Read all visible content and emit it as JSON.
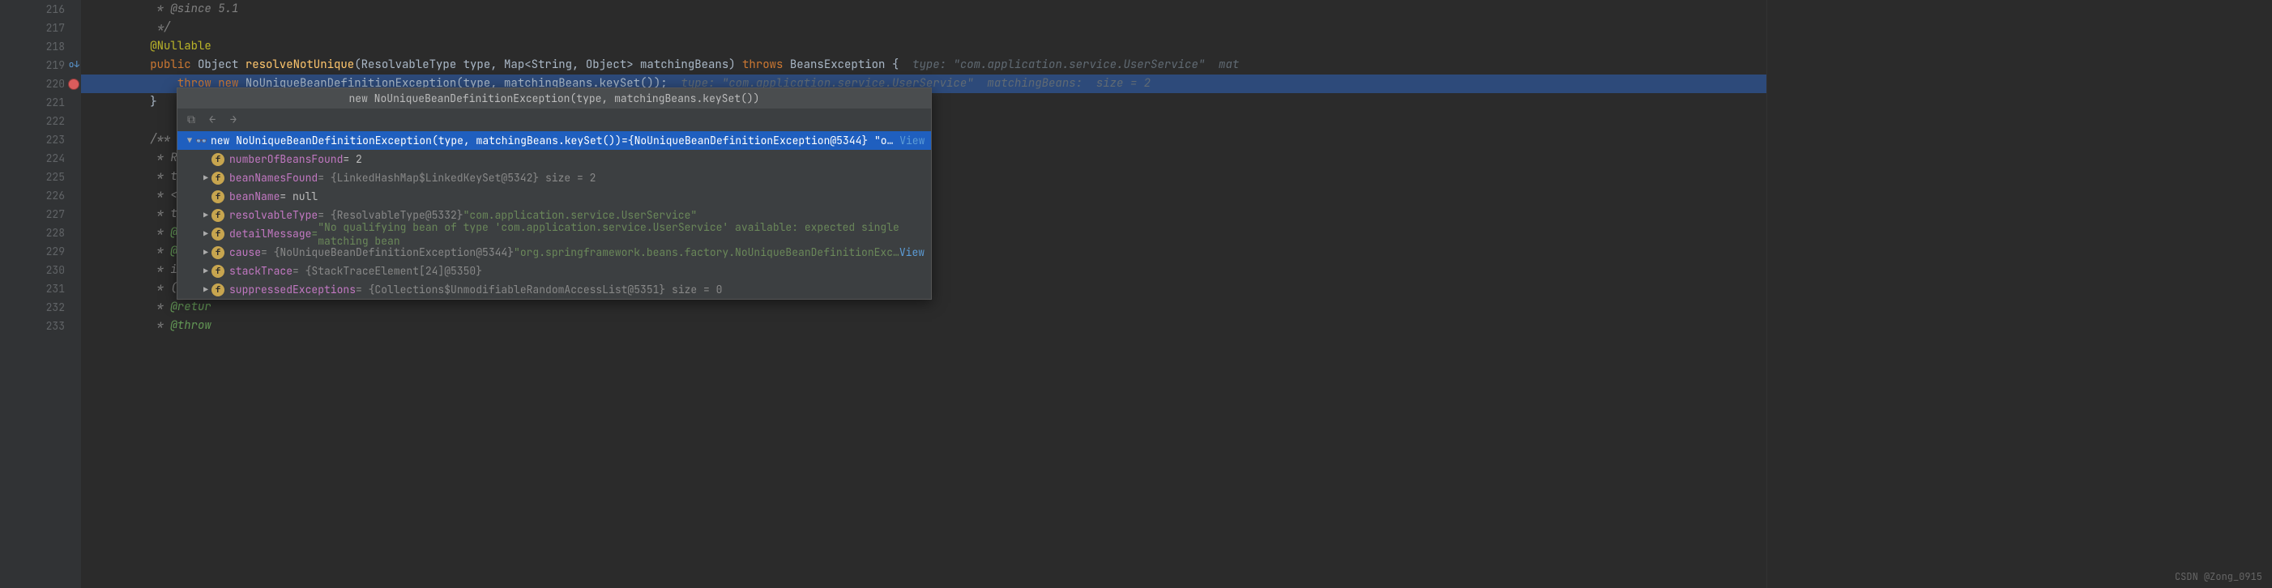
{
  "gutter": {
    "lines": [
      "216",
      "217",
      "218",
      "219",
      "220",
      "221",
      "222",
      "223",
      "224",
      "225",
      "226",
      "227",
      "228",
      "229",
      "230",
      "231",
      "232",
      "233"
    ]
  },
  "code": {
    "l216": "         * @since 5.1",
    "l217": "         */",
    "l218_ann": "@Nullable",
    "l219_kw1": "public",
    "l219_t1": " Object ",
    "l219_m": "resolveNotUnique",
    "l219_p": "(ResolvableType type, Map<String, Object> matchingBeans) ",
    "l219_kw2": "throws",
    "l219_t2": " BeansException {",
    "l219_hint": "  type: \"com.application.service.UserService\"  mat",
    "l220_kw1": "throw",
    "l220_sp": " ",
    "l220_kw2": "new",
    "l220_t": " NoUniqueBeanDefinitionException(type, matchingBeans.keySet());",
    "l220_hint": "  type: \"com.application.service.UserService\"  matchingBeans:  size = 2",
    "l221": "        }",
    "l222": "",
    "l223": "        /**",
    "l224": "         * Resolv",
    "l225": "         * throwi",
    "l226": "         * <p>Sub",
    "l227": "         * to opt",
    "l228": "         * @param",
    "l229": "         * @param",
    "l230": "         * instan",
    "l231": "         * (quali",
    "l232": "         * @retur",
    "l233": "         * @throw"
  },
  "popup": {
    "title": "new NoUniqueBeanDefinitionException(type, matchingBeans.keySet())",
    "root": {
      "expr": "new NoUniqueBeanDefinitionException(type, matchingBeans.keySet())",
      "eq": " = ",
      "val": "{NoUniqueBeanDefinitionException@5344} \"o…",
      "view": "View"
    },
    "rows": [
      {
        "indent": 1,
        "expand": "",
        "name": "numberOfBeansFound",
        "val": " = 2",
        "cls": "fval"
      },
      {
        "indent": 1,
        "expand": "▶",
        "name": "beanNamesFound",
        "val": " = {LinkedHashMap$LinkedKeySet@5342}  size = 2",
        "cls": "ftype"
      },
      {
        "indent": 1,
        "expand": "",
        "name": "beanName",
        "val": " = null",
        "cls": "fval"
      },
      {
        "indent": 1,
        "expand": "▶",
        "name": "resolvableType",
        "val": " = {ResolvableType@5332} ",
        "str": "\"com.application.service.UserService\"",
        "cls": "ftype"
      },
      {
        "indent": 1,
        "expand": "▶",
        "name": "detailMessage",
        "val": " = ",
        "str": "\"No qualifying bean of type 'com.application.service.UserService' available: expected single matching bean",
        "cls": "fstr"
      },
      {
        "indent": 1,
        "expand": "▶",
        "name": "cause",
        "val": " = {NoUniqueBeanDefinitionException@5344} ",
        "str": "\"org.springframework.beans.factory.NoUniqueBeanDefinitionExc…",
        "view": "View",
        "cls": "ftype"
      },
      {
        "indent": 1,
        "expand": "▶",
        "name": "stackTrace",
        "val": " = {StackTraceElement[24]@5350}",
        "cls": "ftype"
      },
      {
        "indent": 1,
        "expand": "▶",
        "name": "suppressedExceptions",
        "val": " = {Collections$UnmodifiableRandomAccessList@5351}  size = 0",
        "cls": "ftype"
      }
    ]
  },
  "watermark": "CSDN @Zong_0915"
}
